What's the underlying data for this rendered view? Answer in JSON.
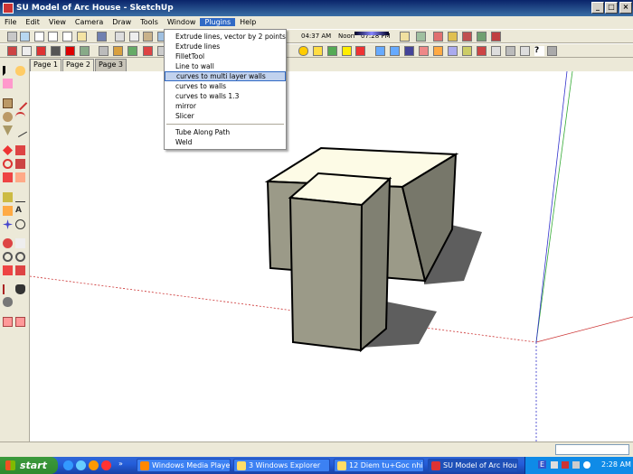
{
  "window": {
    "title": "SU Model of Arc House - SketchUp"
  },
  "menubar": {
    "items": [
      "File",
      "Edit",
      "View",
      "Camera",
      "Draw",
      "Tools",
      "Window",
      "Plugins",
      "Help"
    ],
    "active": "Plugins"
  },
  "toolbar": {
    "time_start": "04:37 AM",
    "time_noon": "Noon",
    "time_end": "07:28 PM"
  },
  "tabs": [
    "Page 1",
    "Page 2",
    "Page 3"
  ],
  "active_tab": "Page 3",
  "plugins_menu": {
    "group1": [
      "Extrude lines, vector by 2 points",
      "Extrude lines",
      "FilletTool",
      "Line to wall",
      "curves to multi layer walls",
      "curves to walls",
      "curves to walls 1.3",
      "mirror",
      "Slicer"
    ],
    "group2": [
      "Tube Along Path",
      "Weld"
    ],
    "highlighted": "curves to multi layer walls"
  },
  "taskbar": {
    "start_label": "start",
    "buttons": [
      "Windows Media Player",
      "3 Windows Explorer",
      "12 Diem tu+Goc nhin...",
      "SU Model of Arc Hou..."
    ],
    "clock": "2:28 AM",
    "lang": "E"
  },
  "colors": {
    "titlebar": "#0a246a",
    "highlight": "#316ac5",
    "wall_fill": "#9b9a88",
    "roof_fill": "#fdfbe6",
    "shadow": "#5e5e5e",
    "axis_red": "#cc3333",
    "axis_green": "#33aa33",
    "axis_blue": "#3333cc"
  },
  "icons": [
    "sketchup-logo-icon",
    "select-arrow-icon",
    "eraser-icon",
    "rectangle-icon",
    "pencil-icon",
    "circle-icon",
    "arc-icon",
    "polygon-icon",
    "push-pull-icon",
    "move-icon",
    "rotate-icon",
    "follow-me-icon",
    "scale-icon",
    "offset-icon",
    "tape-measure-icon",
    "paint-bucket-icon",
    "orbit-icon",
    "pan-icon",
    "zoom-icon",
    "zoom-extents-icon",
    "walk-icon",
    "look-around-icon",
    "section-plane-icon"
  ]
}
